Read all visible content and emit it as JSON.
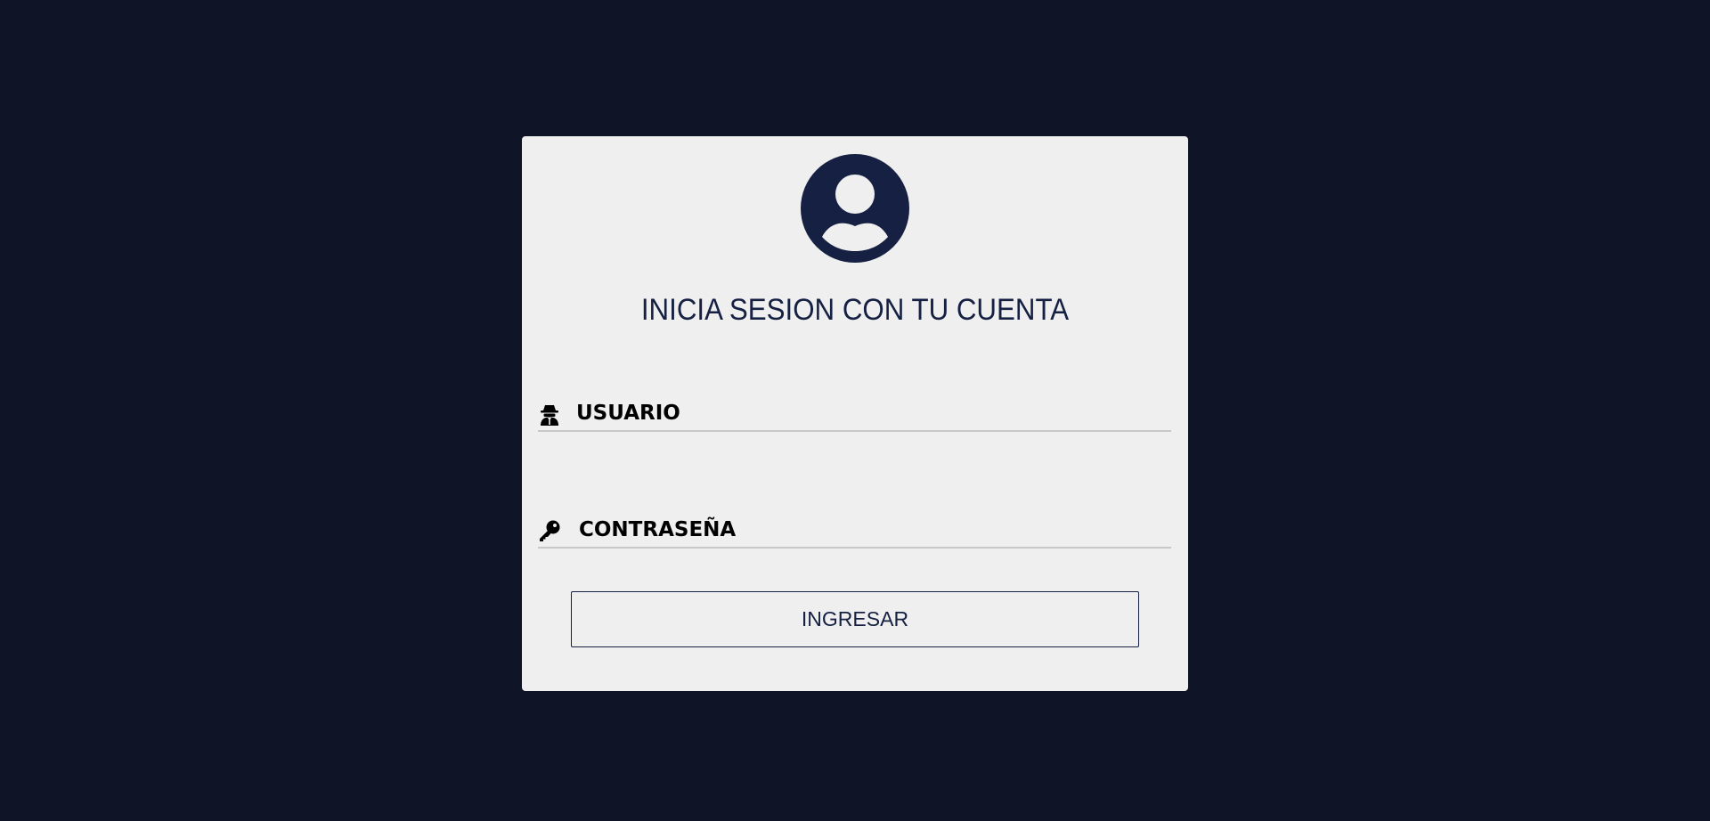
{
  "login": {
    "avatar_icon": "user-circle-icon",
    "title": "INICIA SESION CON TU CUENTA",
    "username": {
      "icon": "user-secret-icon",
      "label": "USUARIO",
      "value": ""
    },
    "password": {
      "icon": "key-icon",
      "label": "CONTRASEÑA",
      "value": ""
    },
    "submit_label": "INGRESAR"
  },
  "colors": {
    "page_background": "#0f1426",
    "card_background": "#efefef",
    "accent": "#152042",
    "divider": "#c8c8c8"
  }
}
